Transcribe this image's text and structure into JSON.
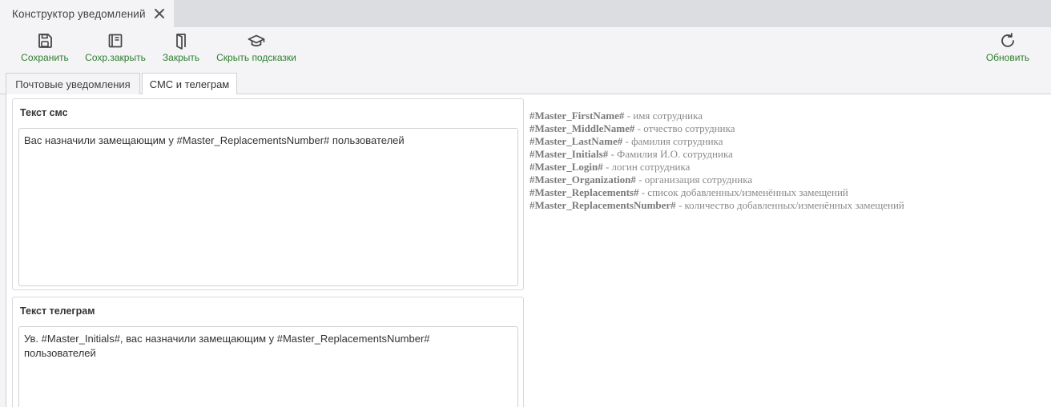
{
  "window": {
    "tab_title": "Конструктор уведомлений"
  },
  "toolbar": {
    "save_label": "Сохранить",
    "save_close_label": "Сохр.закрыть",
    "close_label": "Закрыть",
    "hide_hints_label": "Скрыть подсказки",
    "refresh_label": "Обновить",
    "accent_color": "#2d7d2d"
  },
  "tabs": [
    {
      "label": "Почтовые уведомления",
      "active": false
    },
    {
      "label": "СМС и телеграм",
      "active": true
    }
  ],
  "sms": {
    "title": "Текст смс",
    "value": "Вас назначили замещающим у #Master_ReplacementsNumber# пользователей"
  },
  "telegram": {
    "title": "Текст телеграм",
    "value": "Ув. #Master_Initials#, вас назначили замещающим у #Master_ReplacementsNumber#\nпользователей"
  },
  "hints": [
    {
      "var": "#Master_FirstName#",
      "desc": " - имя сотрудника"
    },
    {
      "var": "#Master_MiddleName#",
      "desc": " - отчество сотрудника"
    },
    {
      "var": "#Master_LastName#",
      "desc": " - фамилия сотрудника"
    },
    {
      "var": "#Master_Initials#",
      "desc": " - Фамилия И.О. сотрудника"
    },
    {
      "var": "#Master_Login#",
      "desc": " - логин сотрудника"
    },
    {
      "var": "#Master_Organization#",
      "desc": " - организация сотрудника"
    },
    {
      "var": "#Master_Replacements#",
      "desc": " - список добавленных/изменённых замещений"
    },
    {
      "var": "#Master_ReplacementsNumber#",
      "desc": " - количество добавленных/изменённых замещений"
    }
  ]
}
